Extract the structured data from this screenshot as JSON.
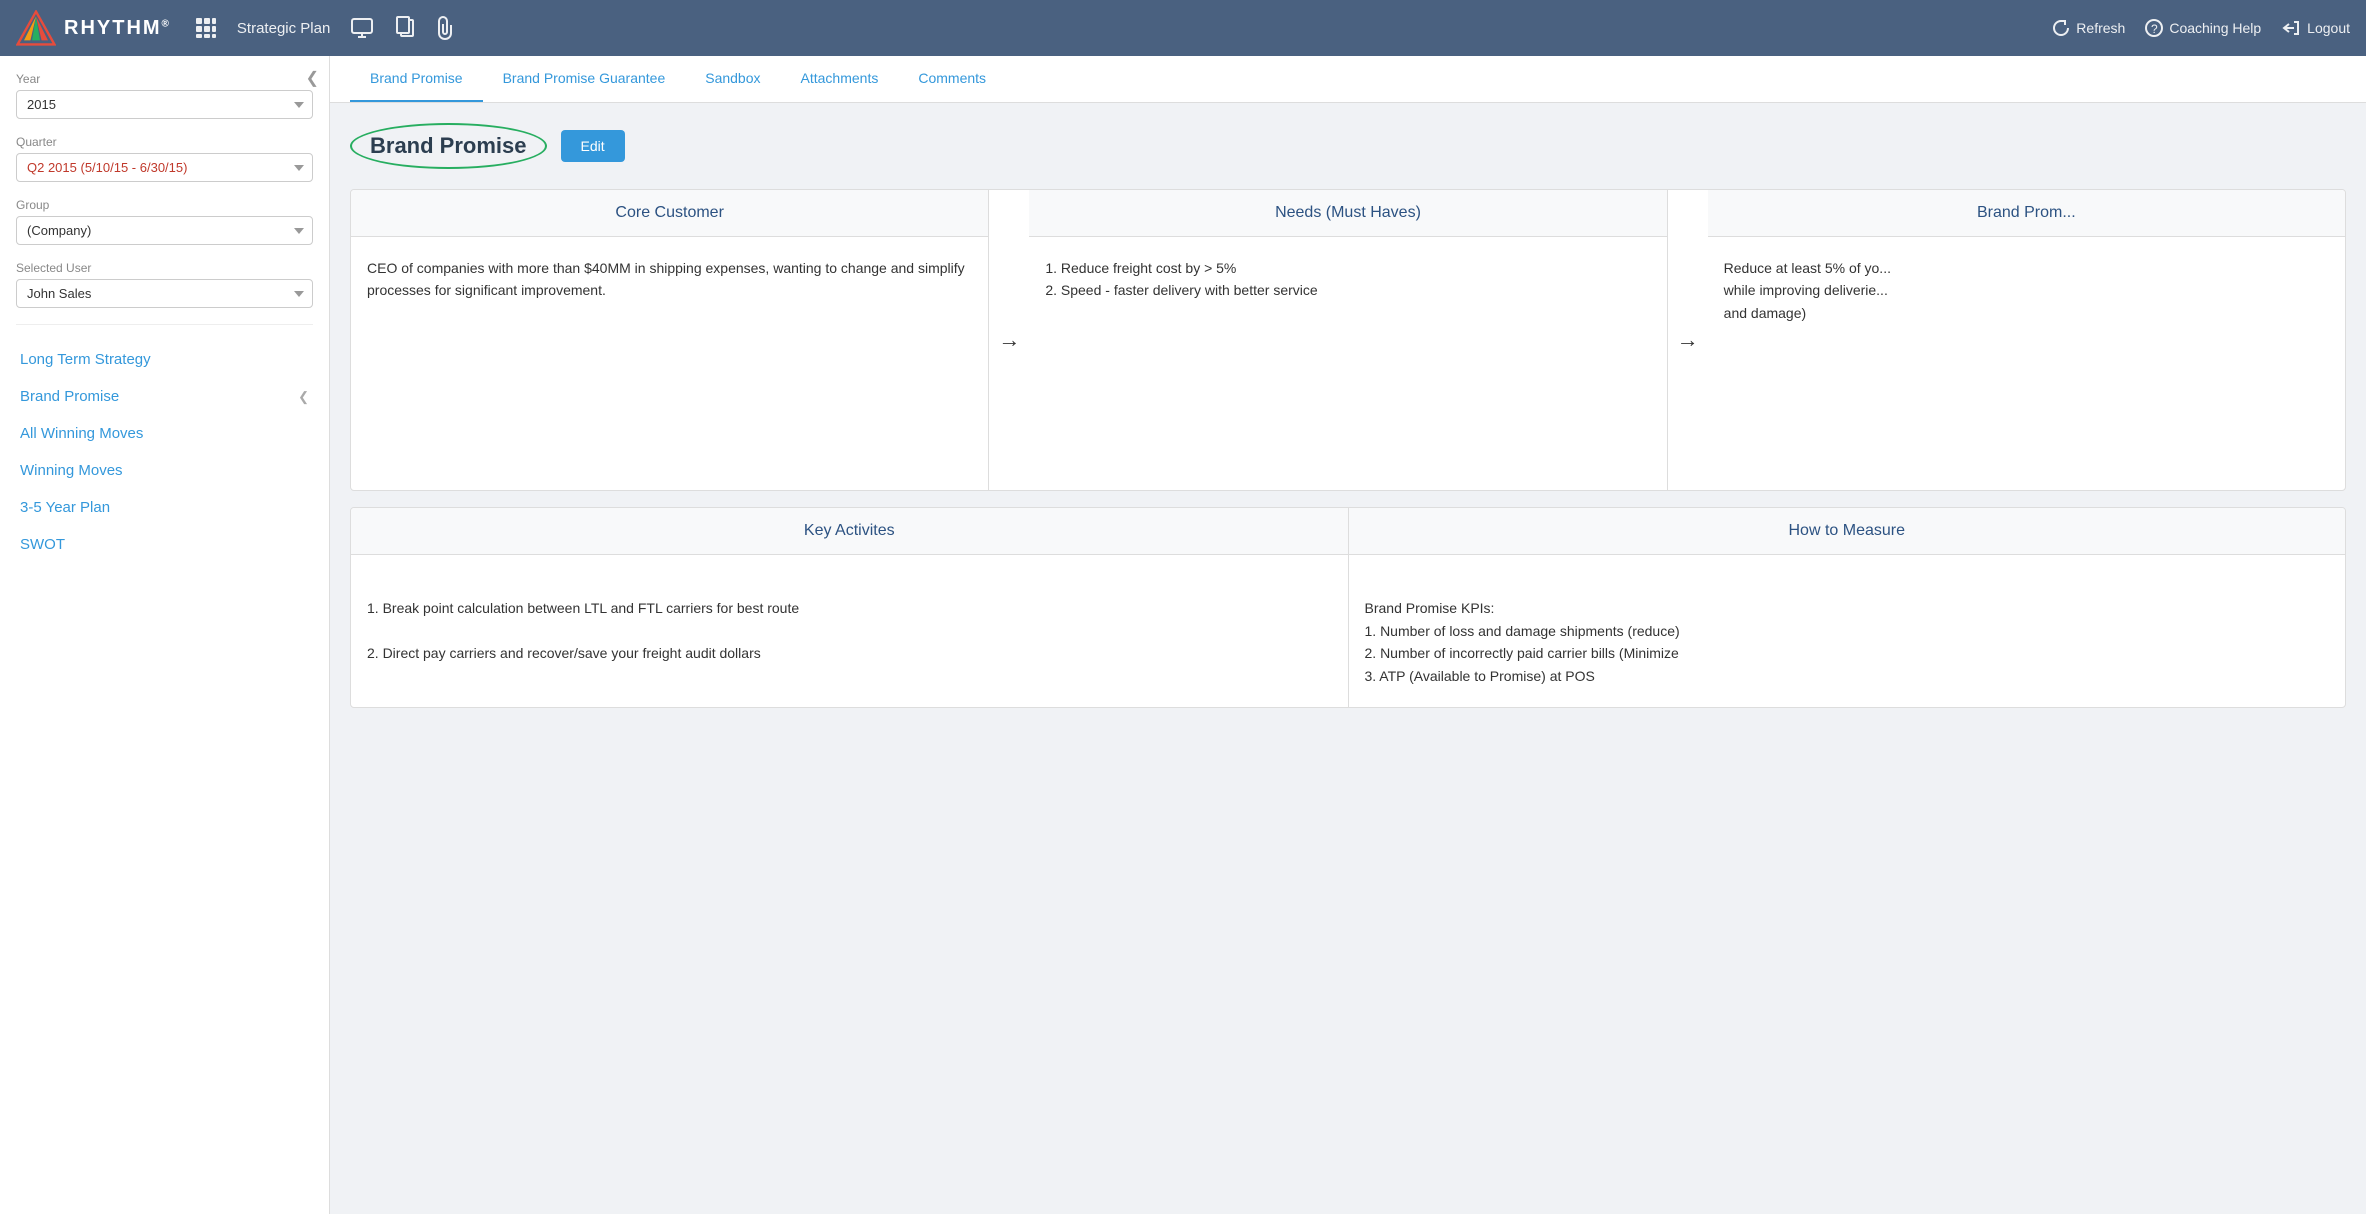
{
  "app": {
    "logo_text": "RHYTHM",
    "logo_reg": "®"
  },
  "topnav": {
    "strategic_plan": "Strategic Plan",
    "refresh": "Refresh",
    "coaching_help": "Coaching Help",
    "logout": "Logout"
  },
  "sidebar": {
    "year_label": "Year",
    "year_value": "2015",
    "quarter_label": "Quarter",
    "quarter_value": "Q2 2015 (5/10/15 - 6/30/15)",
    "group_label": "Group",
    "group_value": "(Company)",
    "user_label": "Selected User",
    "user_value": "John Sales",
    "nav_items": [
      {
        "id": "long-term-strategy",
        "label": "Long Term Strategy",
        "active": false,
        "chevron": false
      },
      {
        "id": "brand-promise",
        "label": "Brand Promise",
        "active": true,
        "chevron": true
      },
      {
        "id": "all-winning-moves",
        "label": "All Winning Moves",
        "active": false,
        "chevron": false
      },
      {
        "id": "winning-moves",
        "label": "Winning Moves",
        "active": false,
        "chevron": false
      },
      {
        "id": "3-5-year-plan",
        "label": "3-5 Year Plan",
        "active": false,
        "chevron": false
      },
      {
        "id": "swot",
        "label": "SWOT",
        "active": false,
        "chevron": false
      }
    ]
  },
  "tabs": [
    {
      "id": "brand-promise-tab",
      "label": "Brand Promise",
      "active": true
    },
    {
      "id": "brand-promise-guarantee-tab",
      "label": "Brand Promise Guarantee",
      "active": false
    },
    {
      "id": "sandbox-tab",
      "label": "Sandbox",
      "active": false
    },
    {
      "id": "attachments-tab",
      "label": "Attachments",
      "active": false
    },
    {
      "id": "comments-tab",
      "label": "Comments",
      "active": false
    }
  ],
  "content": {
    "section_title": "Brand Promise",
    "edit_button": "Edit",
    "cards_top": [
      {
        "id": "core-customer",
        "header": "Core Customer",
        "body": "CEO of companies with more than $40MM in shipping expenses, wanting to change and simplify processes for significant improvement."
      },
      {
        "id": "needs-must-haves",
        "header": "Needs (Must Haves)",
        "body": "1. Reduce freight cost by > 5%\n2. Speed - faster delivery with better service"
      },
      {
        "id": "brand-promise-top",
        "header": "Brand Prom...",
        "body": "Reduce at least 5% of yo... while improving deliverie... and damage)"
      }
    ],
    "cards_bottom": [
      {
        "id": "key-activities",
        "header": "Key Activites",
        "body": "1. Break point calculation between LTL and FTL carriers for best route\n\n2. Direct pay carriers and recover/save your freight audit dollars"
      },
      {
        "id": "how-to-measure",
        "header": "How to Measure",
        "body": "Brand Promise KPIs:\n1. Number of loss and damage shipments (reduce)\n2. Number of incorrectly paid carrier bills (Minimize\n3. ATP (Available to Promise) at POS"
      }
    ]
  }
}
